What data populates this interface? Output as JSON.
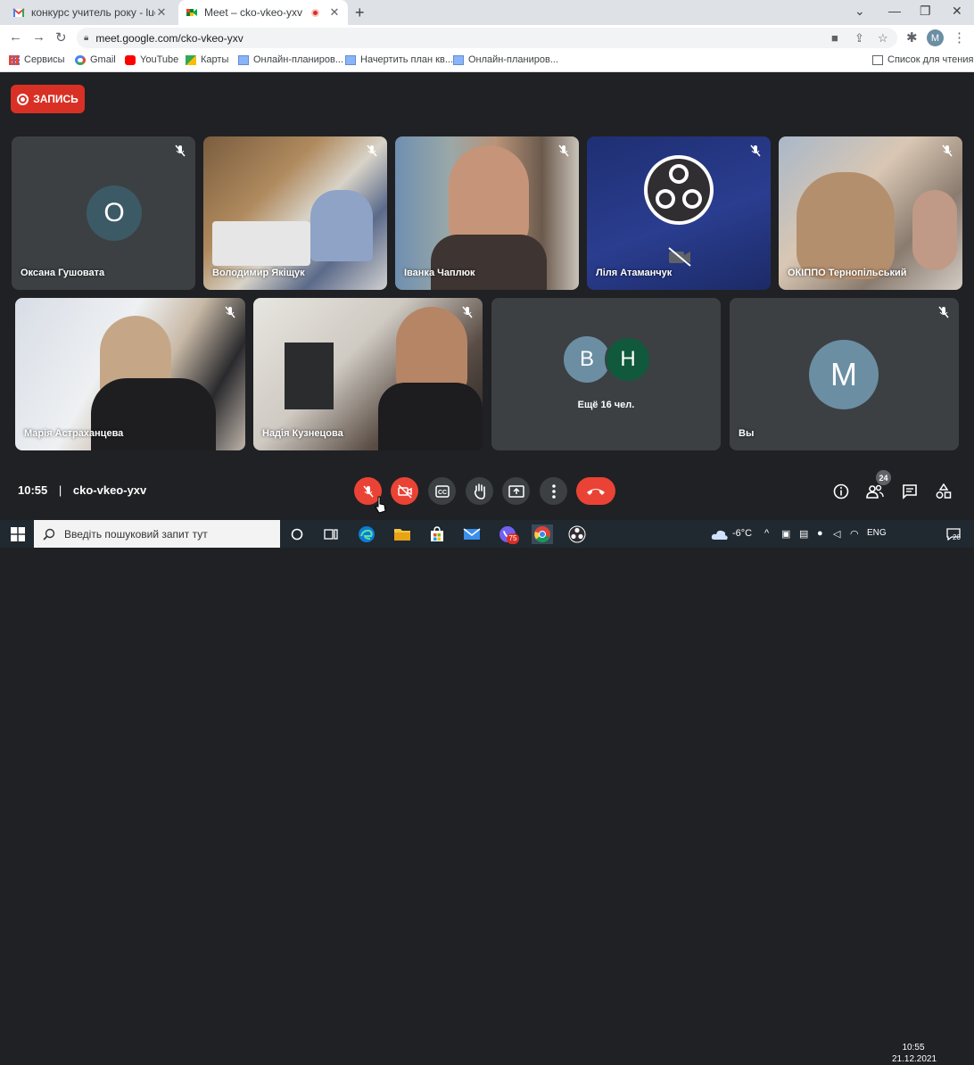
{
  "browser": {
    "tabs": [
      {
        "title": "конкурс учитель року - luchynm",
        "active": false
      },
      {
        "title": "Meet – cko-vkeo-yxv",
        "active": true
      }
    ],
    "url": "meet.google.com/cko-vkeo-yxv",
    "profile_initial": "M",
    "bookmarks": [
      "Сервисы",
      "Gmail",
      "YouTube",
      "Карты",
      "Онлайн-планиров...",
      "Начертить план кв...",
      "Онлайн-планиров..."
    ],
    "reading_list": "Список для чтения"
  },
  "meet": {
    "record_label": "ЗАПИСЬ",
    "participants": [
      {
        "name": "Оксана Гушовата",
        "avatar": "О"
      },
      {
        "name": "Володимир Якіщук"
      },
      {
        "name": "Іванка Чаплюк"
      },
      {
        "name": "Ліля Атаманчук"
      },
      {
        "name": "ОКІППО Тернопільський"
      },
      {
        "name": "Марія Астраханцева"
      },
      {
        "name": "Надія Кузнецова"
      }
    ],
    "more": {
      "avatars": [
        "B",
        "H"
      ],
      "label": "Ещё 16 чел."
    },
    "self": {
      "name": "Вы",
      "avatar": "M"
    },
    "time": "10:55",
    "code": "cko-vkeo-yxv",
    "participant_count": "24",
    "colors": {
      "record": "#d93025",
      "danger": "#ea4335",
      "bg": "#202124",
      "tile": "#3c4043"
    }
  },
  "taskbar": {
    "search_placeholder": "Введіть пошуковий запит тут",
    "weather": "-6°C",
    "lang": "ENG",
    "time": "10:55",
    "date": "21.12.2021",
    "notifications": "20",
    "viber_badge": "75"
  }
}
